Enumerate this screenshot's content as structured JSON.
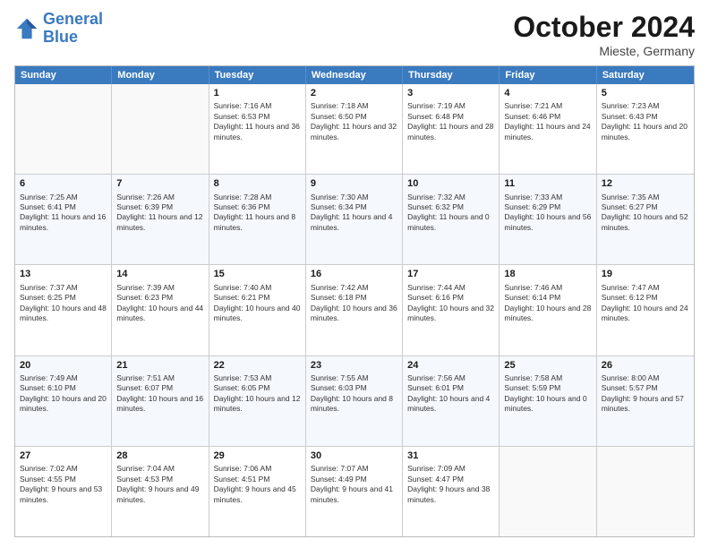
{
  "header": {
    "logo": {
      "line1": "General",
      "line2": "Blue"
    },
    "title": "October 2024",
    "location": "Mieste, Germany"
  },
  "days_of_week": [
    "Sunday",
    "Monday",
    "Tuesday",
    "Wednesday",
    "Thursday",
    "Friday",
    "Saturday"
  ],
  "weeks": [
    [
      {
        "day": "",
        "info": ""
      },
      {
        "day": "",
        "info": ""
      },
      {
        "day": "1",
        "info": "Sunrise: 7:16 AM\nSunset: 6:53 PM\nDaylight: 11 hours and 36 minutes."
      },
      {
        "day": "2",
        "info": "Sunrise: 7:18 AM\nSunset: 6:50 PM\nDaylight: 11 hours and 32 minutes."
      },
      {
        "day": "3",
        "info": "Sunrise: 7:19 AM\nSunset: 6:48 PM\nDaylight: 11 hours and 28 minutes."
      },
      {
        "day": "4",
        "info": "Sunrise: 7:21 AM\nSunset: 6:46 PM\nDaylight: 11 hours and 24 minutes."
      },
      {
        "day": "5",
        "info": "Sunrise: 7:23 AM\nSunset: 6:43 PM\nDaylight: 11 hours and 20 minutes."
      }
    ],
    [
      {
        "day": "6",
        "info": "Sunrise: 7:25 AM\nSunset: 6:41 PM\nDaylight: 11 hours and 16 minutes."
      },
      {
        "day": "7",
        "info": "Sunrise: 7:26 AM\nSunset: 6:39 PM\nDaylight: 11 hours and 12 minutes."
      },
      {
        "day": "8",
        "info": "Sunrise: 7:28 AM\nSunset: 6:36 PM\nDaylight: 11 hours and 8 minutes."
      },
      {
        "day": "9",
        "info": "Sunrise: 7:30 AM\nSunset: 6:34 PM\nDaylight: 11 hours and 4 minutes."
      },
      {
        "day": "10",
        "info": "Sunrise: 7:32 AM\nSunset: 6:32 PM\nDaylight: 11 hours and 0 minutes."
      },
      {
        "day": "11",
        "info": "Sunrise: 7:33 AM\nSunset: 6:29 PM\nDaylight: 10 hours and 56 minutes."
      },
      {
        "day": "12",
        "info": "Sunrise: 7:35 AM\nSunset: 6:27 PM\nDaylight: 10 hours and 52 minutes."
      }
    ],
    [
      {
        "day": "13",
        "info": "Sunrise: 7:37 AM\nSunset: 6:25 PM\nDaylight: 10 hours and 48 minutes."
      },
      {
        "day": "14",
        "info": "Sunrise: 7:39 AM\nSunset: 6:23 PM\nDaylight: 10 hours and 44 minutes."
      },
      {
        "day": "15",
        "info": "Sunrise: 7:40 AM\nSunset: 6:21 PM\nDaylight: 10 hours and 40 minutes."
      },
      {
        "day": "16",
        "info": "Sunrise: 7:42 AM\nSunset: 6:18 PM\nDaylight: 10 hours and 36 minutes."
      },
      {
        "day": "17",
        "info": "Sunrise: 7:44 AM\nSunset: 6:16 PM\nDaylight: 10 hours and 32 minutes."
      },
      {
        "day": "18",
        "info": "Sunrise: 7:46 AM\nSunset: 6:14 PM\nDaylight: 10 hours and 28 minutes."
      },
      {
        "day": "19",
        "info": "Sunrise: 7:47 AM\nSunset: 6:12 PM\nDaylight: 10 hours and 24 minutes."
      }
    ],
    [
      {
        "day": "20",
        "info": "Sunrise: 7:49 AM\nSunset: 6:10 PM\nDaylight: 10 hours and 20 minutes."
      },
      {
        "day": "21",
        "info": "Sunrise: 7:51 AM\nSunset: 6:07 PM\nDaylight: 10 hours and 16 minutes."
      },
      {
        "day": "22",
        "info": "Sunrise: 7:53 AM\nSunset: 6:05 PM\nDaylight: 10 hours and 12 minutes."
      },
      {
        "day": "23",
        "info": "Sunrise: 7:55 AM\nSunset: 6:03 PM\nDaylight: 10 hours and 8 minutes."
      },
      {
        "day": "24",
        "info": "Sunrise: 7:56 AM\nSunset: 6:01 PM\nDaylight: 10 hours and 4 minutes."
      },
      {
        "day": "25",
        "info": "Sunrise: 7:58 AM\nSunset: 5:59 PM\nDaylight: 10 hours and 0 minutes."
      },
      {
        "day": "26",
        "info": "Sunrise: 8:00 AM\nSunset: 5:57 PM\nDaylight: 9 hours and 57 minutes."
      }
    ],
    [
      {
        "day": "27",
        "info": "Sunrise: 7:02 AM\nSunset: 4:55 PM\nDaylight: 9 hours and 53 minutes."
      },
      {
        "day": "28",
        "info": "Sunrise: 7:04 AM\nSunset: 4:53 PM\nDaylight: 9 hours and 49 minutes."
      },
      {
        "day": "29",
        "info": "Sunrise: 7:06 AM\nSunset: 4:51 PM\nDaylight: 9 hours and 45 minutes."
      },
      {
        "day": "30",
        "info": "Sunrise: 7:07 AM\nSunset: 4:49 PM\nDaylight: 9 hours and 41 minutes."
      },
      {
        "day": "31",
        "info": "Sunrise: 7:09 AM\nSunset: 4:47 PM\nDaylight: 9 hours and 38 minutes."
      },
      {
        "day": "",
        "info": ""
      },
      {
        "day": "",
        "info": ""
      }
    ]
  ]
}
